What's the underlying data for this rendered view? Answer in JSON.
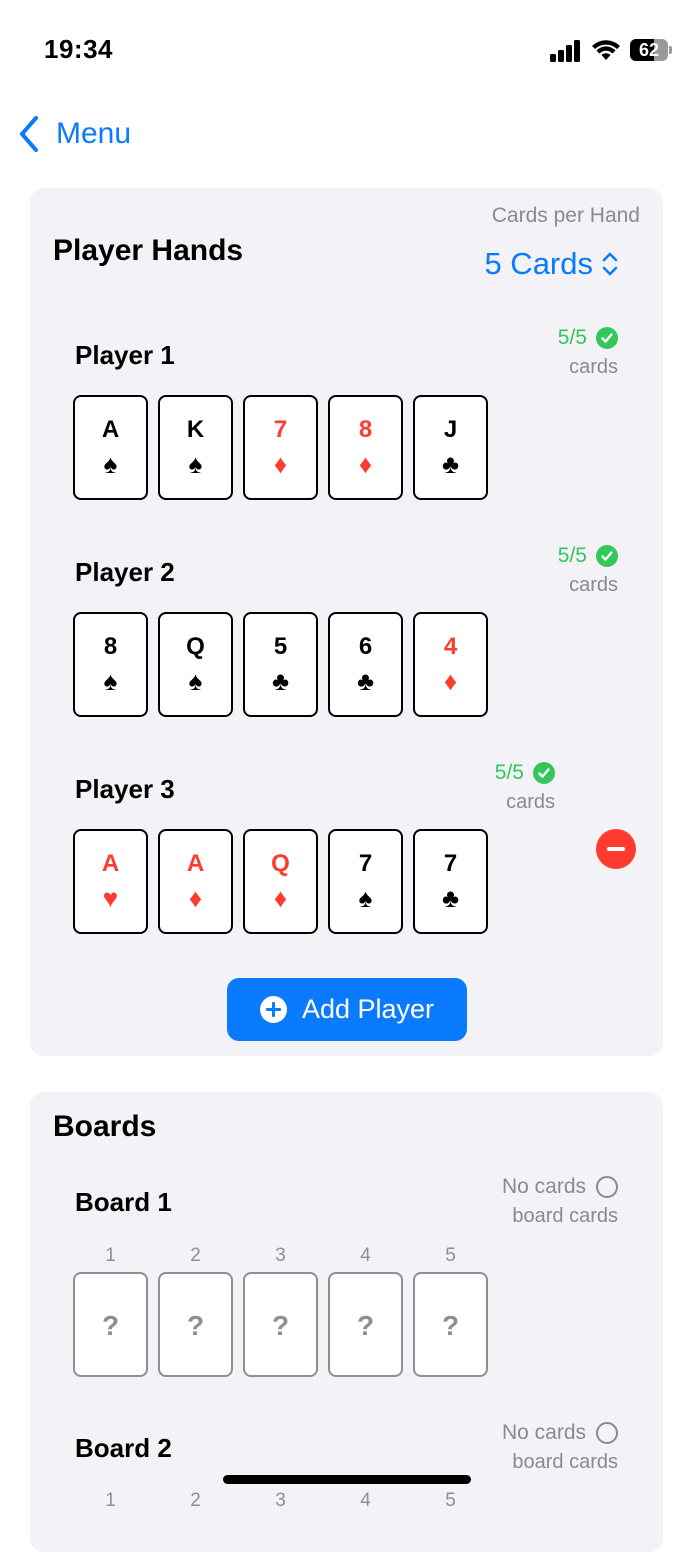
{
  "status_bar": {
    "time": "19:34",
    "battery": "62",
    "battery_level": 0.62
  },
  "nav": {
    "back_label": "Menu"
  },
  "hands": {
    "title": "Player Hands",
    "cards_per_hand_label": "Cards per Hand",
    "cards_per_hand_value": "5 Cards",
    "players": [
      {
        "name": "Player 1",
        "count": "5/5",
        "sub": "cards",
        "cards": [
          {
            "rank": "A",
            "suit": "♠",
            "color": "#000000"
          },
          {
            "rank": "K",
            "suit": "♠",
            "color": "#000000"
          },
          {
            "rank": "7",
            "suit": "♦",
            "color": "#ff3b30"
          },
          {
            "rank": "8",
            "suit": "♦",
            "color": "#ff3b30"
          },
          {
            "rank": "J",
            "suit": "♣",
            "color": "#000000"
          }
        ]
      },
      {
        "name": "Player 2",
        "count": "5/5",
        "sub": "cards",
        "cards": [
          {
            "rank": "8",
            "suit": "♠",
            "color": "#000000"
          },
          {
            "rank": "Q",
            "suit": "♠",
            "color": "#000000"
          },
          {
            "rank": "5",
            "suit": "♣",
            "color": "#000000"
          },
          {
            "rank": "6",
            "suit": "♣",
            "color": "#000000"
          },
          {
            "rank": "4",
            "suit": "♦",
            "color": "#ff3b30"
          }
        ]
      },
      {
        "name": "Player 3",
        "count": "5/5",
        "sub": "cards",
        "cards": [
          {
            "rank": "A",
            "suit": "♥",
            "color": "#ff3b30"
          },
          {
            "rank": "A",
            "suit": "♦",
            "color": "#ff3b30"
          },
          {
            "rank": "Q",
            "suit": "♦",
            "color": "#ff3b30"
          },
          {
            "rank": "7",
            "suit": "♠",
            "color": "#000000"
          },
          {
            "rank": "7",
            "suit": "♣",
            "color": "#000000"
          }
        ]
      }
    ],
    "add_player_label": "Add Player"
  },
  "boards": {
    "title": "Boards",
    "items": [
      {
        "name": "Board 1",
        "status": "No cards",
        "sub": "board cards",
        "slots": [
          "1",
          "2",
          "3",
          "4",
          "5"
        ],
        "placeholder": "?"
      },
      {
        "name": "Board 2",
        "status": "No cards",
        "sub": "board cards",
        "slots": [
          "1",
          "2",
          "3",
          "4",
          "5"
        ],
        "placeholder": "?"
      }
    ]
  },
  "colors": {
    "accent": "#0a7aff",
    "success": "#34c759",
    "destructive": "#ff3b30",
    "section_bg": "#f2f2f7"
  },
  "icons": [
    "chevron-left-icon",
    "updown-chevron-icon",
    "checkmark-circle-icon",
    "minus-circle-icon",
    "plus-circle-icon",
    "empty-circle-icon"
  ]
}
